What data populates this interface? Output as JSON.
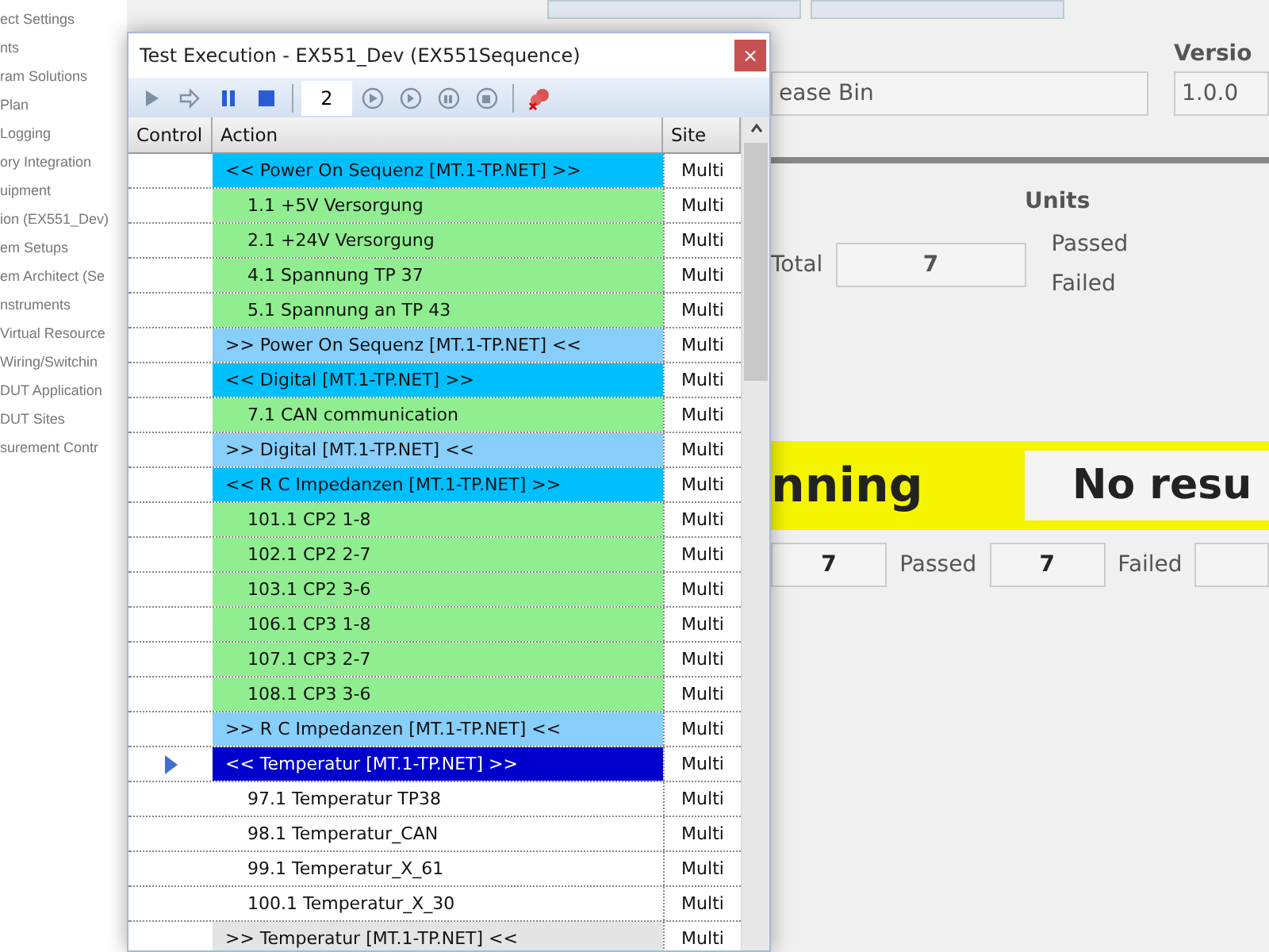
{
  "sidebar": {
    "items": [
      "ect Settings",
      "nts",
      "ram Solutions",
      "Plan",
      "Logging",
      "ory Integration",
      "uipment",
      "ion (EX551_Dev)",
      "em Setups",
      "em Architect (Se",
      "nstruments",
      "Virtual Resource",
      "Wiring/Switchin",
      "DUT Application",
      "DUT Sites",
      "surement Contr"
    ]
  },
  "main": {
    "bin_field": "ease Bin",
    "version_label": "Versio",
    "version_field": "1.0.0",
    "units_title": "Units",
    "total_label": "Total",
    "total_value": "7",
    "passed_label": "Passed",
    "failed_label": "Failed",
    "status_text": "nning",
    "result_text": "No resu",
    "counts": [
      {
        "value": "7"
      },
      {
        "label": "Passed",
        "value": "7"
      },
      {
        "label": "Failed"
      }
    ]
  },
  "dialog": {
    "title": "Test Execution - EX551_Dev (EX551Sequence)",
    "close": "×",
    "loop_count": "2",
    "columns": [
      "Control",
      "Action",
      "Site"
    ],
    "rows": [
      {
        "kind": "group",
        "action": "<< Power On Sequenz [MT.1-TP.NET] >>",
        "site": "Multi",
        "color": "#00bfff",
        "selected": false
      },
      {
        "kind": "step",
        "action": "1.1 +5V Versorgung",
        "site": "Multi",
        "color": "#90ee90",
        "selected": false
      },
      {
        "kind": "step",
        "action": "2.1 +24V Versorgung",
        "site": "Multi",
        "color": "#90ee90",
        "selected": false
      },
      {
        "kind": "step",
        "action": "4.1 Spannung TP 37",
        "site": "Multi",
        "color": "#90ee90",
        "selected": false
      },
      {
        "kind": "step",
        "action": "5.1 Spannung an TP 43",
        "site": "Multi",
        "color": "#90ee90",
        "selected": false
      },
      {
        "kind": "group",
        "action": ">> Power On Sequenz [MT.1-TP.NET] <<",
        "site": "Multi",
        "color": "#87cefa",
        "selected": false
      },
      {
        "kind": "group",
        "action": "<< Digital [MT.1-TP.NET] >>",
        "site": "Multi",
        "color": "#00bfff",
        "selected": false
      },
      {
        "kind": "step",
        "action": "7.1 CAN communication",
        "site": "Multi",
        "color": "#90ee90",
        "selected": false
      },
      {
        "kind": "group",
        "action": ">> Digital [MT.1-TP.NET] <<",
        "site": "Multi",
        "color": "#87cefa",
        "selected": false
      },
      {
        "kind": "group",
        "action": "<< R C Impedanzen [MT.1-TP.NET] >>",
        "site": "Multi",
        "color": "#00bfff",
        "selected": false
      },
      {
        "kind": "step",
        "action": "101.1 CP2 1-8",
        "site": "Multi",
        "color": "#90ee90",
        "selected": false
      },
      {
        "kind": "step",
        "action": "102.1 CP2 2-7",
        "site": "Multi",
        "color": "#90ee90",
        "selected": false
      },
      {
        "kind": "step",
        "action": "103.1 CP2 3-6",
        "site": "Multi",
        "color": "#90ee90",
        "selected": false
      },
      {
        "kind": "step",
        "action": "106.1 CP3 1-8",
        "site": "Multi",
        "color": "#90ee90",
        "selected": false
      },
      {
        "kind": "step",
        "action": "107.1 CP3 2-7",
        "site": "Multi",
        "color": "#90ee90",
        "selected": false
      },
      {
        "kind": "step",
        "action": "108.1 CP3 3-6",
        "site": "Multi",
        "color": "#90ee90",
        "selected": false
      },
      {
        "kind": "group",
        "action": ">> R C Impedanzen [MT.1-TP.NET] <<",
        "site": "Multi",
        "color": "#87cefa",
        "selected": false
      },
      {
        "kind": "group",
        "action": "<< Temperatur [MT.1-TP.NET] >>",
        "site": "Multi",
        "color": "#0000cd",
        "selected": true
      },
      {
        "kind": "step",
        "action": "97.1 Temperatur TP38",
        "site": "Multi",
        "color": "#ffffff",
        "selected": false
      },
      {
        "kind": "step",
        "action": "98.1 Temperatur_CAN",
        "site": "Multi",
        "color": "#ffffff",
        "selected": false
      },
      {
        "kind": "step",
        "action": "99.1 Temperatur_X_61",
        "site": "Multi",
        "color": "#ffffff",
        "selected": false
      },
      {
        "kind": "step",
        "action": "100.1 Temperatur_X_30",
        "site": "Multi",
        "color": "#ffffff",
        "selected": false
      },
      {
        "kind": "group",
        "action": ">> Temperatur [MT.1-TP.NET] <<",
        "site": "Multi",
        "color": "#e4e4e4",
        "selected": false
      }
    ]
  }
}
